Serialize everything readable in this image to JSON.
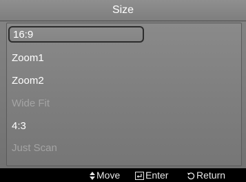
{
  "menu": {
    "title": "Size",
    "items": [
      {
        "label": "16:9",
        "state": "selected"
      },
      {
        "label": "Zoom1",
        "state": "enabled"
      },
      {
        "label": "Zoom2",
        "state": "enabled"
      },
      {
        "label": "Wide Fit",
        "state": "disabled"
      },
      {
        "label": "4:3",
        "state": "enabled"
      },
      {
        "label": "Just Scan",
        "state": "disabled"
      }
    ]
  },
  "footer": {
    "move_label": "Move",
    "enter_label": "Enter",
    "return_label": "Return",
    "move_icon": "updown-arrow-icon",
    "enter_icon": "enter-icon",
    "return_icon": "return-icon"
  },
  "colors": {
    "background": "#7f7f7f",
    "text": "#ffffff",
    "disabled_text": "#a4a4a4",
    "selection_border": "#2c2c2c",
    "footer_background": "#000000"
  }
}
